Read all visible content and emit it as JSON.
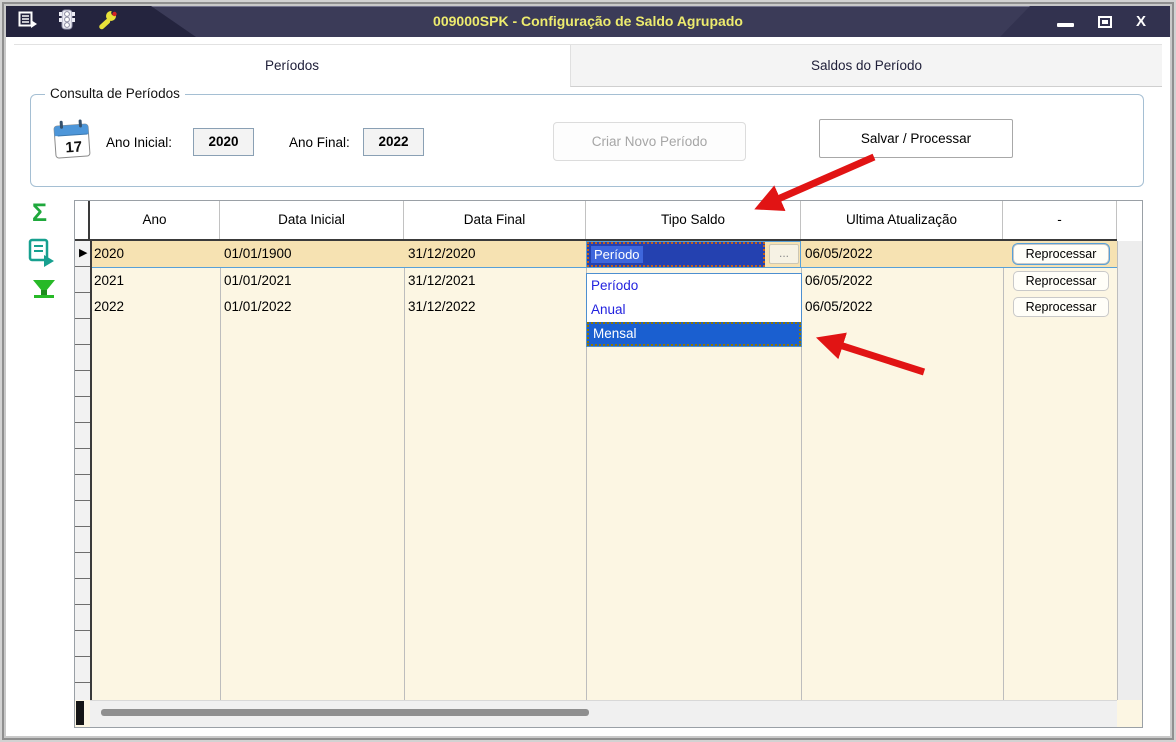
{
  "window": {
    "title": "009000SPK - Configuração de Saldo Agrupado",
    "controls": {
      "close_label": "X"
    }
  },
  "titlebar_icons": [
    "menu-export-icon",
    "traffic-light-icon",
    "wrench-icon"
  ],
  "tabs": {
    "periodos": "Períodos",
    "saldos": "Saldos do Período"
  },
  "consulta": {
    "legend": "Consulta de Períodos",
    "calendar_day": "17",
    "ano_inicial_label": "Ano Inicial:",
    "ano_inicial_value": "2020",
    "ano_final_label": "Ano Final:",
    "ano_final_value": "2022",
    "criar_novo_label": "Criar Novo Período",
    "salvar_label": "Salvar / Processar"
  },
  "grid": {
    "columns": [
      "Ano",
      "Data Inicial",
      "Data Final",
      "Tipo Saldo",
      "Ultima Atualização",
      "-"
    ],
    "rows": [
      {
        "ano": "2020",
        "data_inicial": "01/01/1900",
        "data_final": "31/12/2020",
        "ultima_atualizacao": "06/05/2022",
        "action": "Reprocessar",
        "selected": true
      },
      {
        "ano": "2021",
        "data_inicial": "01/01/2021",
        "data_final": "31/12/2021",
        "ultima_atualizacao": "06/05/2022",
        "action": "Reprocessar",
        "selected": false
      },
      {
        "ano": "2022",
        "data_inicial": "01/01/2022",
        "data_final": "31/12/2022",
        "ultima_atualizacao": "06/05/2022",
        "action": "Reprocessar",
        "selected": false
      }
    ],
    "editor": {
      "value": "Período",
      "ellipsis": "..."
    },
    "dropdown": {
      "options": [
        "Período",
        "Anual",
        "Mensal"
      ],
      "highlighted": "Mensal"
    }
  },
  "colors": {
    "titlebar_bg": "#3B3B58",
    "title_text": "#EDEB6E",
    "grid_body": "#FCF6E3",
    "selected_row": "#F6E2B2",
    "dropdown_highlight": "#1A5FD0",
    "dropdown_option_text": "#2222DF",
    "editor_bg": "#2441B0",
    "marquee_border": "#C2601A",
    "annotation_arrow": "#E11414",
    "toolbar_icon_green": "#1FA83C",
    "toolbar_icon_teal": "#17A08F"
  }
}
